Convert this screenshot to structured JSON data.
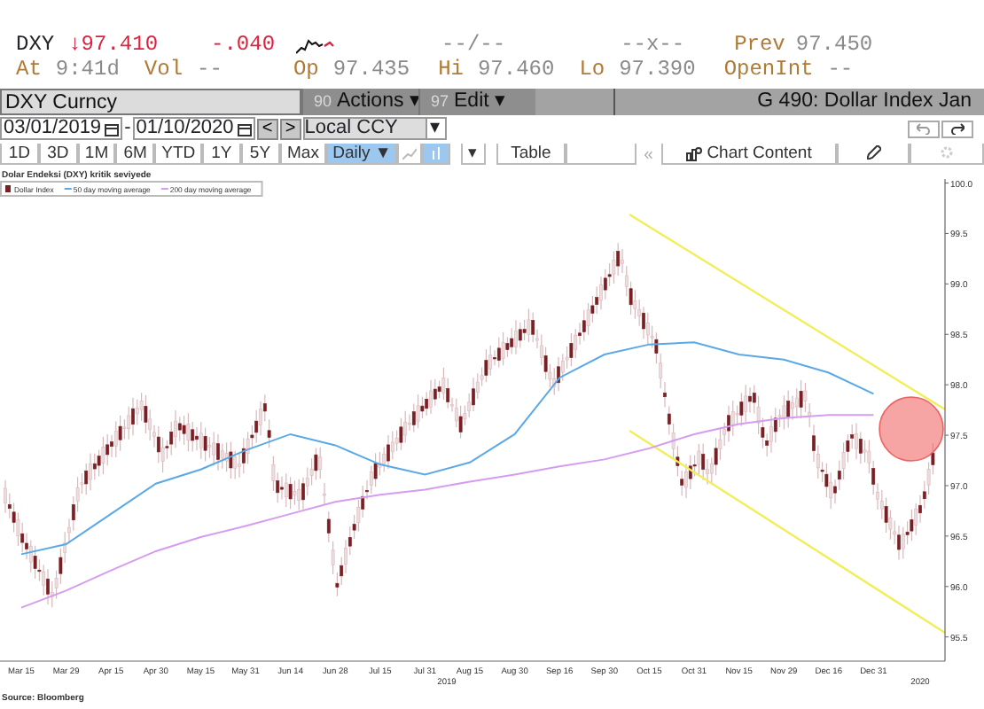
{
  "quote": {
    "ticker": "DXY",
    "direction": "↓",
    "price": "97.410",
    "change": "-.040",
    "bid_ask": "--/--",
    "size": "--x--",
    "prev_label": "Prev",
    "prev": "97.450"
  },
  "quote_line2": [
    {
      "label": "At",
      "value": "9:41d"
    },
    {
      "label": "Vol",
      "value": "--"
    },
    {
      "label": "Op",
      "value": "97.435"
    },
    {
      "label": "Hi",
      "value": "97.460"
    },
    {
      "label": "Lo",
      "value": "97.390"
    },
    {
      "label": "OpenInt",
      "value": "--"
    }
  ],
  "toolbar": {
    "security": "DXY Curncy",
    "menus": [
      {
        "number": "90",
        "label": "Actions",
        "caret": "▾"
      },
      {
        "number": "97",
        "label": "Edit",
        "caret": "▾"
      }
    ],
    "title": "G 490: Dollar Index Jan"
  },
  "date_range": {
    "start": "03/01/2019",
    "separator": "-",
    "end": "01/10/2020",
    "prev": "<",
    "next": ">",
    "currency": "Local CCY",
    "currency_caret": "▾"
  },
  "periods": [
    "1D",
    "3D",
    "1M",
    "6M",
    "YTD",
    "1Y",
    "5Y",
    "Max"
  ],
  "frequency": {
    "label": "Daily",
    "caret": "▼"
  },
  "chart_tools": {
    "caret": "▾",
    "table": "Table",
    "collapse": "«",
    "chart_content": "Chart Content"
  },
  "chart": {
    "title": "Dolar Endeksi (DXY) kritik seviyede",
    "price_series": {
      "label": "Dollar Index",
      "color": "#7a1f23"
    },
    "chart_data": {
      "type": "line",
      "categories": [
        "Mar 15",
        "Mar 29",
        "Apr 15",
        "Apr 30",
        "May 15",
        "May 31",
        "Jun 14",
        "Jun 28",
        "Jul 15",
        "Jul 31",
        "Aug 15",
        "Aug 30",
        "Sep 16",
        "Sep 30",
        "Oct 15",
        "Oct 31",
        "Nov 15",
        "Nov 29",
        "Dec 16",
        "Dec 31"
      ],
      "series": [
        {
          "name": "50 day moving average",
          "color": "#5aa9e6",
          "values": [
            96.32,
            96.42,
            96.72,
            97.02,
            97.16,
            97.35,
            97.51,
            97.4,
            97.21,
            97.11,
            97.23,
            97.51,
            98.07,
            98.3,
            98.4,
            98.42,
            98.3,
            98.25,
            98.12,
            97.91
          ]
        },
        {
          "name": "200 day moving average",
          "color": "#d59cf0",
          "values": [
            95.79,
            95.96,
            96.16,
            96.35,
            96.49,
            96.6,
            96.72,
            96.84,
            96.91,
            96.96,
            97.04,
            97.11,
            97.19,
            97.26,
            97.37,
            97.51,
            97.61,
            97.67,
            97.7,
            97.7
          ]
        }
      ],
      "ylim": [
        95.26,
        100.04
      ],
      "legend": true,
      "yticks": [
        {
          "value": 100.0,
          "label": "100.0"
        },
        {
          "value": 99.5,
          "label": "99.5"
        },
        {
          "value": 99.0,
          "label": "99.0"
        },
        {
          "value": 98.5,
          "label": "98.5"
        },
        {
          "value": 98.0,
          "label": "98.0"
        },
        {
          "value": 97.5,
          "label": "97.5"
        },
        {
          "value": 97.0,
          "label": "97.0"
        },
        {
          "value": 96.5,
          "label": "96.5"
        },
        {
          "value": 96.0,
          "label": "96.0"
        },
        {
          "value": 95.5,
          "label": "95.5"
        }
      ]
    },
    "years": [
      "2019",
      "2020"
    ],
    "source": "Source: Bloomberg"
  }
}
